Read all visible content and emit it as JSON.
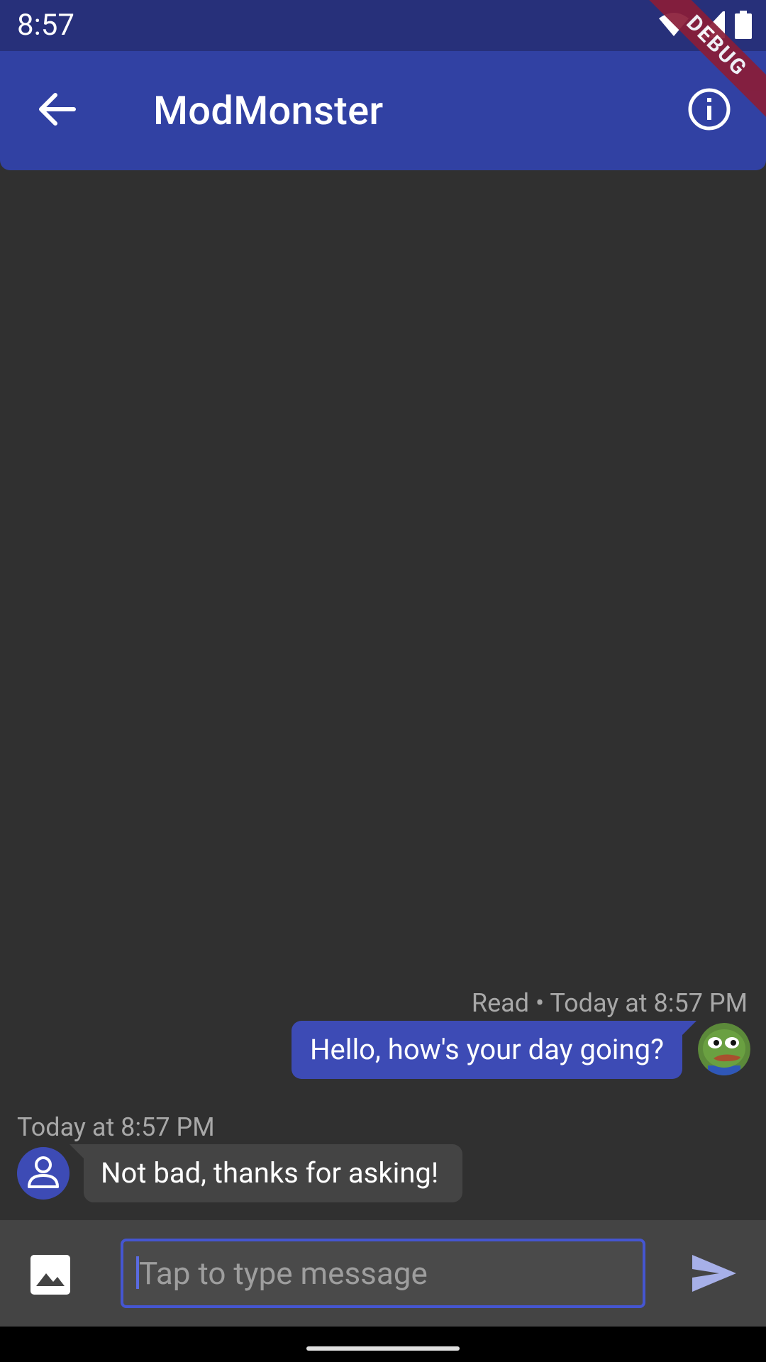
{
  "status_bar": {
    "time": "8:57",
    "icons": [
      "wifi-icon",
      "signal-icon",
      "battery-icon"
    ]
  },
  "debug_banner": "DEBUG",
  "app_bar": {
    "title": "ModMonster",
    "back_icon": "arrow-back-icon",
    "info_icon": "info-icon"
  },
  "messages": [
    {
      "direction": "outgoing",
      "meta": "Read • Today at 8:57 PM",
      "text": "Hello, how's your day going?",
      "avatar": "pepe-avatar"
    },
    {
      "direction": "incoming",
      "meta": "Today at 8:57 PM",
      "text": "Not bad, thanks for asking!",
      "avatar": "person-icon"
    }
  ],
  "composer": {
    "placeholder": "Tap to type message",
    "value": "",
    "image_icon": "image-icon",
    "send_icon": "send-icon"
  },
  "colors": {
    "status_bar": "#27307a",
    "app_bar": "#3141a3",
    "background": "#303030",
    "outgoing_bubble": "#3d4bb5",
    "incoming_bubble": "#444444",
    "composer": "#444444",
    "input_border": "#4556d1"
  }
}
